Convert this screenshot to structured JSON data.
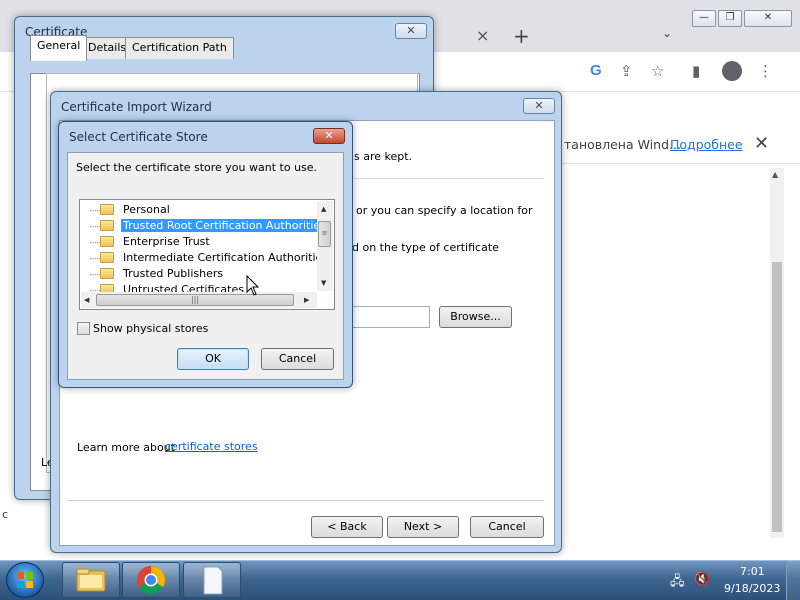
{
  "browser": {
    "tab_close": "×",
    "new_tab": "+",
    "tab_search": "⌄",
    "window_controls": [
      "—",
      "❐",
      "✕"
    ],
    "toolbar_icons": [
      "google-icon",
      "share-icon",
      "star-icon",
      "sidepanel-icon",
      "profile-icon",
      "menu-icon"
    ],
    "google_letter": "G",
    "share": "⇪",
    "star": "☆",
    "sidepanel": "▮",
    "menu": "⋮",
    "infobar": {
      "text": "тановлена Wind...",
      "link": "Подробнее",
      "close": "✕"
    },
    "scroll_up": "▲"
  },
  "certificate_dialog": {
    "title": "Certificate",
    "close": "✕",
    "tabs": [
      "General",
      "Details",
      "Certification Path"
    ],
    "partial_text": "Le",
    "edge_text": "c"
  },
  "import_wizard": {
    "title": "Certificate Import Wizard",
    "close": "✕",
    "text_right_1": "s are kept.",
    "text_right_2": "or you can specify a location for",
    "text_right_3": "d on the type of certificate",
    "browse_label": "Browse...",
    "learn_more_prefix": "Learn more about ",
    "learn_more_link": "certificate stores",
    "back_label": "< Back",
    "next_label": "Next >",
    "cancel_label": "Cancel"
  },
  "store_dialog": {
    "title": "Select Certificate Store",
    "close": "✕",
    "prompt": "Select the certificate store you want to use.",
    "stores": [
      {
        "label": "Personal",
        "selected": false
      },
      {
        "label": "Trusted Root Certification Authorities",
        "selected": true
      },
      {
        "label": "Enterprise Trust",
        "selected": false
      },
      {
        "label": "Intermediate Certification Authorities",
        "selected": false
      },
      {
        "label": "Trusted Publishers",
        "selected": false
      },
      {
        "label": "Untrusted Certificates",
        "selected": false
      }
    ],
    "show_physical_label": "Show physical stores",
    "show_physical_checked": false,
    "ok_label": "OK",
    "cancel_label": "Cancel",
    "scroll_grip": "≡",
    "hscroll_grip": "|||",
    "arrow_up": "▲",
    "arrow_down": "▼",
    "arrow_left": "◀",
    "arrow_right": "▶"
  },
  "taskbar": {
    "apps": [
      "explorer-icon",
      "chrome-icon",
      "notepad-icon"
    ],
    "clock_time": "7:01",
    "clock_date": "9/18/2023",
    "tray_network": "🖧",
    "tray_volume": "🔇"
  },
  "colors": {
    "selection": "#3399ff",
    "link": "#0066cc",
    "chrome_link": "#1a73e8",
    "taskbar": "#3d6690"
  }
}
